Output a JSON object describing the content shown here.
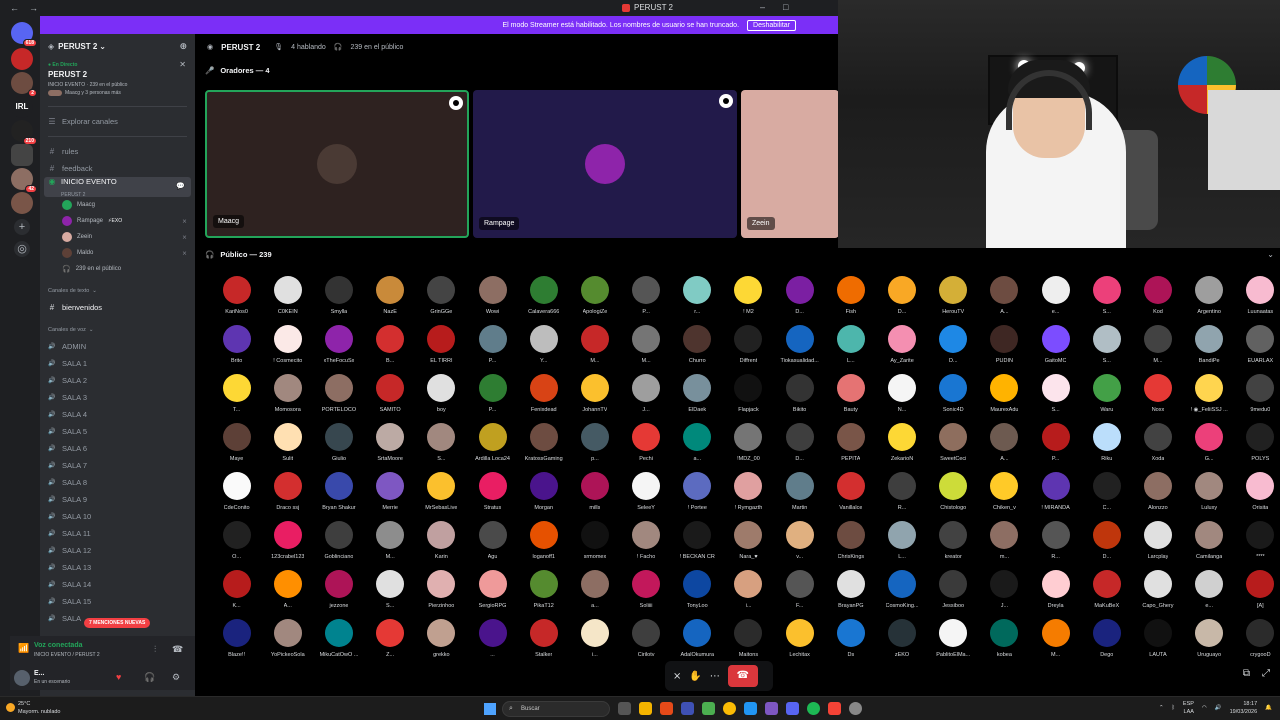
{
  "window": {
    "title": "PERUST 2"
  },
  "banner": {
    "text": "El modo Streamer está habilitado. Los nombres de usuario se han truncado.",
    "button": "Deshabilitar"
  },
  "server": {
    "name": "PERUST 2"
  },
  "rail": {
    "badges": [
      "618",
      "2",
      "210",
      "42"
    ],
    "label_irl": "IRL"
  },
  "event": {
    "status": "En Directo",
    "title": "PERUST 2",
    "subtitle": "INICIO EVENTO · 239 en el público",
    "people": "Maacg y 3 personas más"
  },
  "sidebar": {
    "explore": "Explorar canales",
    "rules": "rules",
    "feedback": "feedback",
    "event_channel": "INICIO EVENTO",
    "event_channel_sub": "PERUST 2",
    "speakers": [
      "Maacg",
      "Rampage",
      "Zeein",
      "Maldo"
    ],
    "rampage_tag": "⚡EXO",
    "audience_count": "239 en el público",
    "text_category": "Canales de texto",
    "text_channel": "bienvenidos",
    "voice_category": "Canales de voz",
    "voice_channels": [
      "ADMIN",
      "SALA 1",
      "SALA 2",
      "SALA 3",
      "SALA 4",
      "SALA 5",
      "SALA 6",
      "SALA 7",
      "SALA 8",
      "SALA 9",
      "SALA 10",
      "SALA 11",
      "SALA 12",
      "SALA 13",
      "SALA 14",
      "SALA 15",
      "SALA"
    ],
    "mentions": "7 MENCIONES NUEVAS"
  },
  "voice_panel": {
    "status": "Voz conectada",
    "location": "INICIO EVENTO / PERUST 2"
  },
  "user_panel": {
    "name": "E...",
    "status": "En un escenario"
  },
  "stage": {
    "name": "PERUST 2",
    "talking": "4 hablando",
    "audience": "239 en el público",
    "speakers_header": "Oradores — 4",
    "tiles": [
      {
        "label": "Maacg",
        "bg": "#2e2220",
        "face": "#4a3a34",
        "border": "#23a55a"
      },
      {
        "label": "Rampage",
        "bg": "#221a4a",
        "face": "#8e24aa",
        "border": ""
      },
      {
        "label": "Zeein",
        "bg": "#d8aba2",
        "face": "",
        "border": ""
      }
    ],
    "audience_header": "Público — 239"
  },
  "audience": [
    {
      "n": "KariÑos0",
      "c": "#c62828"
    },
    {
      "n": "C0KEIN",
      "c": "#e0e0e0"
    },
    {
      "n": "Smylla",
      "c": "#333333"
    },
    {
      "n": "NazE",
      "c": "#c98a3a"
    },
    {
      "n": "GrinGGe",
      "c": "#444444"
    },
    {
      "n": "Wowi",
      "c": "#8d6e63"
    },
    {
      "n": "Calavera666",
      "c": "#2e7d32"
    },
    {
      "n": "ApologiZe",
      "c": "#558b2f"
    },
    {
      "n": "P...",
      "c": "#555555"
    },
    {
      "n": "r...",
      "c": "#80cbc4"
    },
    {
      "n": "! M2",
      "c": "#fdd835"
    },
    {
      "n": "D...",
      "c": "#7b1fa2"
    },
    {
      "n": "Fish",
      "c": "#ef6c00"
    },
    {
      "n": "D...",
      "c": "#f9a825"
    },
    {
      "n": "HerouTV",
      "c": "#d4af37"
    },
    {
      "n": "A...",
      "c": "#6d4c41"
    },
    {
      "n": "e...",
      "c": "#eeeeee"
    },
    {
      "n": "S...",
      "c": "#ec407a"
    },
    {
      "n": "Kod",
      "c": "#ad1457"
    },
    {
      "n": "Argentino",
      "c": "#9e9e9e"
    },
    {
      "n": "Luunaatas",
      "c": "#f8bbd0"
    },
    {
      "n": "Brito",
      "c": "#5e35b1"
    },
    {
      "n": "! Cosmecito",
      "c": "#fbe9e7"
    },
    {
      "n": "xTheFocuSx",
      "c": "#8e24aa"
    },
    {
      "n": "B...",
      "c": "#d32f2f"
    },
    {
      "n": "EL TIRRI",
      "c": "#b71c1c"
    },
    {
      "n": "P...",
      "c": "#607d8b"
    },
    {
      "n": "Y...",
      "c": "#bdbdbd"
    },
    {
      "n": "M...",
      "c": "#c62828"
    },
    {
      "n": "M...",
      "c": "#757575"
    },
    {
      "n": "Churro",
      "c": "#4e342e"
    },
    {
      "n": "Diffrent",
      "c": "#212121"
    },
    {
      "n": "Tiokasualidad...",
      "c": "#1565c0"
    },
    {
      "n": "L...",
      "c": "#4db6ac"
    },
    {
      "n": "Ay_Zarite",
      "c": "#f48fb1"
    },
    {
      "n": "D...",
      "c": "#1e88e5"
    },
    {
      "n": "PUDIN",
      "c": "#3e2723"
    },
    {
      "n": "GaitoMC",
      "c": "#7c4dff"
    },
    {
      "n": "S...",
      "c": "#b0bec5"
    },
    {
      "n": "M...",
      "c": "#424242"
    },
    {
      "n": "BandiPe",
      "c": "#90a4ae"
    },
    {
      "n": "EUARLAX",
      "c": "#616161"
    },
    {
      "n": "T...",
      "c": "#fdd835"
    },
    {
      "n": "Momosora",
      "c": "#a1887f"
    },
    {
      "n": "PORTELOCO",
      "c": "#8d6e63"
    },
    {
      "n": "SAMITO",
      "c": "#c62828"
    },
    {
      "n": "boy",
      "c": "#e0e0e0"
    },
    {
      "n": "P...",
      "c": "#2e7d32"
    },
    {
      "n": "Fenixdead",
      "c": "#d84315"
    },
    {
      "n": "JohannTV",
      "c": "#fbc02d"
    },
    {
      "n": "J...",
      "c": "#9e9e9e"
    },
    {
      "n": "ElDaek",
      "c": "#78909c"
    },
    {
      "n": "Flapjack",
      "c": "#111111"
    },
    {
      "n": "Bikito",
      "c": "#333333"
    },
    {
      "n": "Bauty",
      "c": "#e57373"
    },
    {
      "n": "N...",
      "c": "#f5f5f5"
    },
    {
      "n": "Sonic4D",
      "c": "#1976d2"
    },
    {
      "n": "MaurexAdu",
      "c": "#ffb300"
    },
    {
      "n": "S...",
      "c": "#fce4ec"
    },
    {
      "n": "Waru",
      "c": "#43a047"
    },
    {
      "n": "Noxx",
      "c": "#e53935"
    },
    {
      "n": "! ◉_FeliiSSJ ...",
      "c": "#ffd54f"
    },
    {
      "n": "9medu0",
      "c": "#424242"
    },
    {
      "n": "Maye",
      "c": "#5d4037"
    },
    {
      "n": "Sulit",
      "c": "#ffe0b2"
    },
    {
      "n": "Giulio",
      "c": "#37474f"
    },
    {
      "n": "SrtaMoore",
      "c": "#bcaaa4"
    },
    {
      "n": "S...",
      "c": "#a1887f"
    },
    {
      "n": "Ardilla Loca24",
      "c": "#c0a020"
    },
    {
      "n": "KratossGaming",
      "c": "#6d4c41"
    },
    {
      "n": "p...",
      "c": "#455a64"
    },
    {
      "n": "Pechi",
      "c": "#e53935"
    },
    {
      "n": "a...",
      "c": "#00897b"
    },
    {
      "n": "!MDZ_00",
      "c": "#757575"
    },
    {
      "n": "D...",
      "c": "#3e3e3e"
    },
    {
      "n": "PEPITA",
      "c": "#795548"
    },
    {
      "n": "ZekarioN",
      "c": "#fdd835"
    },
    {
      "n": "SweetCeci",
      "c": "#8e6e5e"
    },
    {
      "n": "A...",
      "c": "#6d5a50"
    },
    {
      "n": "P...",
      "c": "#b71c1c"
    },
    {
      "n": "Riku",
      "c": "#bbdefb"
    },
    {
      "n": "Xoda",
      "c": "#424242"
    },
    {
      "n": "G...",
      "c": "#ec407a"
    },
    {
      "n": "POLYS",
      "c": "#212121"
    },
    {
      "n": "CdeConito",
      "c": "#fafafa"
    },
    {
      "n": "Draco ssj",
      "c": "#d32f2f"
    },
    {
      "n": "Bryan Shakur",
      "c": "#3949ab"
    },
    {
      "n": "Merrie",
      "c": "#7e57c2"
    },
    {
      "n": "MrSebasLive",
      "c": "#fbc02d"
    },
    {
      "n": "Stratus",
      "c": "#e91e63"
    },
    {
      "n": "Morgan",
      "c": "#4a148c"
    },
    {
      "n": "mills",
      "c": "#ad1457"
    },
    {
      "n": "SeleeY",
      "c": "#f5f5f5"
    },
    {
      "n": "! Portee",
      "c": "#5c6bc0"
    },
    {
      "n": "! Rymgazth",
      "c": "#e0a0a0"
    },
    {
      "n": "Martin",
      "c": "#607d8b"
    },
    {
      "n": "Vanillalce",
      "c": "#d32f2f"
    },
    {
      "n": "R...",
      "c": "#3e3e3e"
    },
    {
      "n": "Chistologo",
      "c": "#cddc39"
    },
    {
      "n": "Chiken_v",
      "c": "#ffca28"
    },
    {
      "n": "! MIRANDA",
      "c": "#5e35b1"
    },
    {
      "n": "C...",
      "c": "#212121"
    },
    {
      "n": "Alonzzo",
      "c": "#8d6e63"
    },
    {
      "n": "Luluxy",
      "c": "#a1887f"
    },
    {
      "n": "Orisita",
      "c": "#f8bbd0"
    },
    {
      "n": "O...",
      "c": "#212121"
    },
    {
      "n": "123crabel123",
      "c": "#e91e63"
    },
    {
      "n": "Goblinciano",
      "c": "#3e3e3e"
    },
    {
      "n": "M...",
      "c": "#8d8d8d"
    },
    {
      "n": "Karin",
      "c": "#c0a0a0"
    },
    {
      "n": "Agu",
      "c": "#4a4a4a"
    },
    {
      "n": "loganoff1",
      "c": "#e65100"
    },
    {
      "n": "srmomex",
      "c": "#111111"
    },
    {
      "n": "! Facho",
      "c": "#a1887f"
    },
    {
      "n": "! BECKAN CR",
      "c": "#1a1a1a"
    },
    {
      "n": "Nara_♥",
      "c": "#9e7b6b"
    },
    {
      "n": "v...",
      "c": "#e0b080"
    },
    {
      "n": "ChrisKings",
      "c": "#6d4c41"
    },
    {
      "n": "L...",
      "c": "#90a4ae"
    },
    {
      "n": "kreator",
      "c": "#424242"
    },
    {
      "n": "m...",
      "c": "#8d6e63"
    },
    {
      "n": "R...",
      "c": "#555555"
    },
    {
      "n": "D...",
      "c": "#bf360c"
    },
    {
      "n": "Larcplay",
      "c": "#e0e0e0"
    },
    {
      "n": "Camilanga",
      "c": "#a1887f"
    },
    {
      "n": "****",
      "c": "#1a1a1a"
    },
    {
      "n": "K...",
      "c": "#b71c1c"
    },
    {
      "n": "A...",
      "c": "#ff8f00"
    },
    {
      "n": "jezzone",
      "c": "#ad1457"
    },
    {
      "n": "S...",
      "c": "#e0e0e0"
    },
    {
      "n": "Pierzinhoo",
      "c": "#e0b0b0"
    },
    {
      "n": "SergioRPG",
      "c": "#ef9a9a"
    },
    {
      "n": "PikaT12",
      "c": "#558b2f"
    },
    {
      "n": "a...",
      "c": "#8d6e63"
    },
    {
      "n": "Soliiii",
      "c": "#c2185b"
    },
    {
      "n": "TonyLoo",
      "c": "#0d47a1"
    },
    {
      "n": "i...",
      "c": "#d7a080"
    },
    {
      "n": "F...",
      "c": "#555555"
    },
    {
      "n": "BrayanPG",
      "c": "#e0e0e0"
    },
    {
      "n": "CosmoKing...",
      "c": "#1565c0"
    },
    {
      "n": "Jessiboo",
      "c": "#3a3a3a"
    },
    {
      "n": "J...",
      "c": "#1a1a1a"
    },
    {
      "n": "Dreyla",
      "c": "#ffcdd2"
    },
    {
      "n": "MaKuBeX",
      "c": "#c62828"
    },
    {
      "n": "Capo_Ghery",
      "c": "#e0e0e0"
    },
    {
      "n": "e...",
      "c": "#d0d0d0"
    },
    {
      "n": "[A]",
      "c": "#b71c1c"
    },
    {
      "n": "Blaze!!",
      "c": "#1a237e"
    },
    {
      "n": "YoPickeoSola",
      "c": "#a1887f"
    },
    {
      "n": "MikuCatOwO ...",
      "c": "#00838f"
    },
    {
      "n": "Z...",
      "c": "#e53935"
    },
    {
      "n": "grekko",
      "c": "#c0a090"
    },
    {
      "n": "...",
      "c": "#4a148c"
    },
    {
      "n": "Stalker",
      "c": "#c62828"
    },
    {
      "n": "i...",
      "c": "#f5e6c8"
    },
    {
      "n": "Cirilotv",
      "c": "#3e3e3e"
    },
    {
      "n": "AdalOkumura",
      "c": "#1565c0"
    },
    {
      "n": "Maitons",
      "c": "#2b2b2b"
    },
    {
      "n": "Lechitax",
      "c": "#fbc02d"
    },
    {
      "n": "Ds",
      "c": "#1976d2"
    },
    {
      "n": "zEKO",
      "c": "#263238"
    },
    {
      "n": "PablitoElMa...",
      "c": "#f5f5f5"
    },
    {
      "n": "kobea",
      "c": "#00695c"
    },
    {
      "n": "M...",
      "c": "#f57c00"
    },
    {
      "n": "Dego",
      "c": "#1a237e"
    },
    {
      "n": "LAUTA",
      "c": "#111111"
    },
    {
      "n": "Uruguayo",
      "c": "#c8b8a8"
    },
    {
      "n": "crygooD",
      "c": "#2b2b2b"
    }
  ],
  "taskbar": {
    "temp": "25°C",
    "weather": "Mayorm. nublado",
    "search": "Buscar",
    "lang1": "ESP",
    "lang2": "LAA",
    "time": "18:17",
    "date": "19/03/2026"
  }
}
